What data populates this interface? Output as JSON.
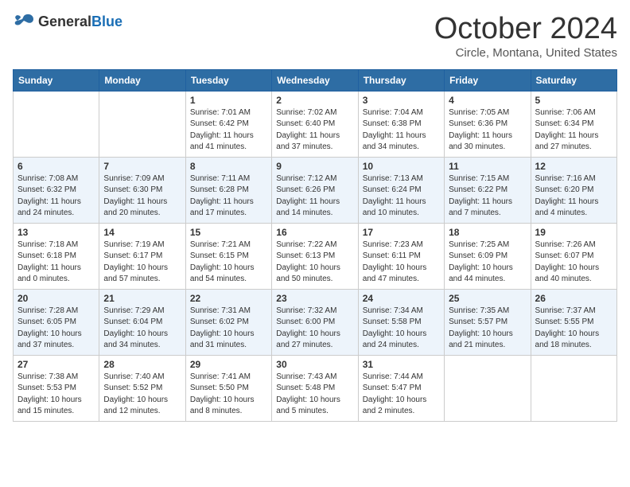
{
  "logo": {
    "general": "General",
    "blue": "Blue"
  },
  "title": "October 2024",
  "location": "Circle, Montana, United States",
  "weekdays": [
    "Sunday",
    "Monday",
    "Tuesday",
    "Wednesday",
    "Thursday",
    "Friday",
    "Saturday"
  ],
  "weeks": [
    [
      {
        "day": "",
        "sunrise": "",
        "sunset": "",
        "daylight": ""
      },
      {
        "day": "",
        "sunrise": "",
        "sunset": "",
        "daylight": ""
      },
      {
        "day": "1",
        "sunrise": "Sunrise: 7:01 AM",
        "sunset": "Sunset: 6:42 PM",
        "daylight": "Daylight: 11 hours and 41 minutes."
      },
      {
        "day": "2",
        "sunrise": "Sunrise: 7:02 AM",
        "sunset": "Sunset: 6:40 PM",
        "daylight": "Daylight: 11 hours and 37 minutes."
      },
      {
        "day": "3",
        "sunrise": "Sunrise: 7:04 AM",
        "sunset": "Sunset: 6:38 PM",
        "daylight": "Daylight: 11 hours and 34 minutes."
      },
      {
        "day": "4",
        "sunrise": "Sunrise: 7:05 AM",
        "sunset": "Sunset: 6:36 PM",
        "daylight": "Daylight: 11 hours and 30 minutes."
      },
      {
        "day": "5",
        "sunrise": "Sunrise: 7:06 AM",
        "sunset": "Sunset: 6:34 PM",
        "daylight": "Daylight: 11 hours and 27 minutes."
      }
    ],
    [
      {
        "day": "6",
        "sunrise": "Sunrise: 7:08 AM",
        "sunset": "Sunset: 6:32 PM",
        "daylight": "Daylight: 11 hours and 24 minutes."
      },
      {
        "day": "7",
        "sunrise": "Sunrise: 7:09 AM",
        "sunset": "Sunset: 6:30 PM",
        "daylight": "Daylight: 11 hours and 20 minutes."
      },
      {
        "day": "8",
        "sunrise": "Sunrise: 7:11 AM",
        "sunset": "Sunset: 6:28 PM",
        "daylight": "Daylight: 11 hours and 17 minutes."
      },
      {
        "day": "9",
        "sunrise": "Sunrise: 7:12 AM",
        "sunset": "Sunset: 6:26 PM",
        "daylight": "Daylight: 11 hours and 14 minutes."
      },
      {
        "day": "10",
        "sunrise": "Sunrise: 7:13 AM",
        "sunset": "Sunset: 6:24 PM",
        "daylight": "Daylight: 11 hours and 10 minutes."
      },
      {
        "day": "11",
        "sunrise": "Sunrise: 7:15 AM",
        "sunset": "Sunset: 6:22 PM",
        "daylight": "Daylight: 11 hours and 7 minutes."
      },
      {
        "day": "12",
        "sunrise": "Sunrise: 7:16 AM",
        "sunset": "Sunset: 6:20 PM",
        "daylight": "Daylight: 11 hours and 4 minutes."
      }
    ],
    [
      {
        "day": "13",
        "sunrise": "Sunrise: 7:18 AM",
        "sunset": "Sunset: 6:18 PM",
        "daylight": "Daylight: 11 hours and 0 minutes."
      },
      {
        "day": "14",
        "sunrise": "Sunrise: 7:19 AM",
        "sunset": "Sunset: 6:17 PM",
        "daylight": "Daylight: 10 hours and 57 minutes."
      },
      {
        "day": "15",
        "sunrise": "Sunrise: 7:21 AM",
        "sunset": "Sunset: 6:15 PM",
        "daylight": "Daylight: 10 hours and 54 minutes."
      },
      {
        "day": "16",
        "sunrise": "Sunrise: 7:22 AM",
        "sunset": "Sunset: 6:13 PM",
        "daylight": "Daylight: 10 hours and 50 minutes."
      },
      {
        "day": "17",
        "sunrise": "Sunrise: 7:23 AM",
        "sunset": "Sunset: 6:11 PM",
        "daylight": "Daylight: 10 hours and 47 minutes."
      },
      {
        "day": "18",
        "sunrise": "Sunrise: 7:25 AM",
        "sunset": "Sunset: 6:09 PM",
        "daylight": "Daylight: 10 hours and 44 minutes."
      },
      {
        "day": "19",
        "sunrise": "Sunrise: 7:26 AM",
        "sunset": "Sunset: 6:07 PM",
        "daylight": "Daylight: 10 hours and 40 minutes."
      }
    ],
    [
      {
        "day": "20",
        "sunrise": "Sunrise: 7:28 AM",
        "sunset": "Sunset: 6:05 PM",
        "daylight": "Daylight: 10 hours and 37 minutes."
      },
      {
        "day": "21",
        "sunrise": "Sunrise: 7:29 AM",
        "sunset": "Sunset: 6:04 PM",
        "daylight": "Daylight: 10 hours and 34 minutes."
      },
      {
        "day": "22",
        "sunrise": "Sunrise: 7:31 AM",
        "sunset": "Sunset: 6:02 PM",
        "daylight": "Daylight: 10 hours and 31 minutes."
      },
      {
        "day": "23",
        "sunrise": "Sunrise: 7:32 AM",
        "sunset": "Sunset: 6:00 PM",
        "daylight": "Daylight: 10 hours and 27 minutes."
      },
      {
        "day": "24",
        "sunrise": "Sunrise: 7:34 AM",
        "sunset": "Sunset: 5:58 PM",
        "daylight": "Daylight: 10 hours and 24 minutes."
      },
      {
        "day": "25",
        "sunrise": "Sunrise: 7:35 AM",
        "sunset": "Sunset: 5:57 PM",
        "daylight": "Daylight: 10 hours and 21 minutes."
      },
      {
        "day": "26",
        "sunrise": "Sunrise: 7:37 AM",
        "sunset": "Sunset: 5:55 PM",
        "daylight": "Daylight: 10 hours and 18 minutes."
      }
    ],
    [
      {
        "day": "27",
        "sunrise": "Sunrise: 7:38 AM",
        "sunset": "Sunset: 5:53 PM",
        "daylight": "Daylight: 10 hours and 15 minutes."
      },
      {
        "day": "28",
        "sunrise": "Sunrise: 7:40 AM",
        "sunset": "Sunset: 5:52 PM",
        "daylight": "Daylight: 10 hours and 12 minutes."
      },
      {
        "day": "29",
        "sunrise": "Sunrise: 7:41 AM",
        "sunset": "Sunset: 5:50 PM",
        "daylight": "Daylight: 10 hours and 8 minutes."
      },
      {
        "day": "30",
        "sunrise": "Sunrise: 7:43 AM",
        "sunset": "Sunset: 5:48 PM",
        "daylight": "Daylight: 10 hours and 5 minutes."
      },
      {
        "day": "31",
        "sunrise": "Sunrise: 7:44 AM",
        "sunset": "Sunset: 5:47 PM",
        "daylight": "Daylight: 10 hours and 2 minutes."
      },
      {
        "day": "",
        "sunrise": "",
        "sunset": "",
        "daylight": ""
      },
      {
        "day": "",
        "sunrise": "",
        "sunset": "",
        "daylight": ""
      }
    ]
  ]
}
